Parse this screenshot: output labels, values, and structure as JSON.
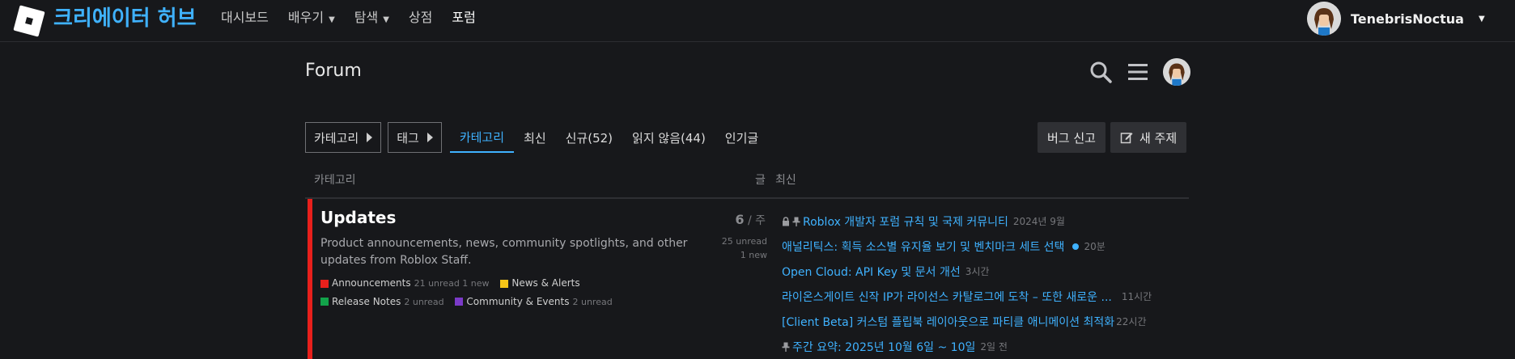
{
  "header": {
    "brand": "크리에이터 허브",
    "nav": [
      {
        "label": "대시보드",
        "has_caret": false
      },
      {
        "label": "배우기",
        "has_caret": true
      },
      {
        "label": "탐색",
        "has_caret": true
      },
      {
        "label": "상점",
        "has_caret": false
      },
      {
        "label": "포럼",
        "has_caret": false
      }
    ],
    "username": "TenebrisNoctua"
  },
  "forum": {
    "title": "Forum",
    "icons": [
      "search-icon",
      "hamburger-menu-icon",
      "user-avatar"
    ]
  },
  "filters": {
    "category_dropdown": "카테고리",
    "tag_dropdown": "태그",
    "tabs": [
      "카테고리",
      "최신",
      "신규(52)",
      "읽지 않음(44)",
      "인기글"
    ],
    "active_tab": "카테고리",
    "bug_report": "버그 신고",
    "new_topic": "새 주제"
  },
  "table": {
    "col_category": "카테고리",
    "col_posts": "글",
    "col_latest": "최신"
  },
  "category": {
    "title": "Updates",
    "color": "#e8201c",
    "description": "Product announcements, news, community spotlights, and other updates from Roblox Staff.",
    "count": "6",
    "count_unit": " / 주",
    "unread": "25 unread",
    "new": "1 new",
    "subcategories": [
      {
        "name": "Announcements",
        "color": "#e8201c",
        "meta": "21 unread 1 new"
      },
      {
        "name": "News & Alerts",
        "color": "#f5c518",
        "meta": ""
      },
      {
        "name": "Release Notes",
        "color": "#12a34a",
        "meta": "2 unread"
      },
      {
        "name": "Community & Events",
        "color": "#7b3ac8",
        "meta": "2 unread"
      }
    ]
  },
  "latest_topics": [
    {
      "title": "Roblox 개발자 포럼 규칙 및 국제 커뮤니티",
      "time": "2024년 9월",
      "icons": [
        "lock-icon",
        "pin-icon"
      ],
      "unread_dot": false
    },
    {
      "title": "애널리틱스: 획득 소스별 유지율 보기 및 벤치마크 세트 선택",
      "time": "20분",
      "icons": [],
      "unread_dot": true
    },
    {
      "title": "Open Cloud: API Key 및 문서 개선",
      "time": "3시간",
      "icons": [],
      "unread_dot": false
    },
    {
      "title": "라이온스게이트 신작 IP가 라이선스 카탈로그에 도착 – 또한 새로운 ...",
      "time": "11시간",
      "icons": [],
      "unread_dot": false
    },
    {
      "title": "[Client Beta] 커스텀 플립북 레이아웃으로 파티클 애니메이션 최적화",
      "time": "22시간",
      "icons": [],
      "unread_dot": false
    },
    {
      "title": "주간 요약: 2025년 10월 6일 ~ 10일",
      "time": "2일 전",
      "icons": [
        "pin-icon"
      ],
      "unread_dot": false
    }
  ]
}
